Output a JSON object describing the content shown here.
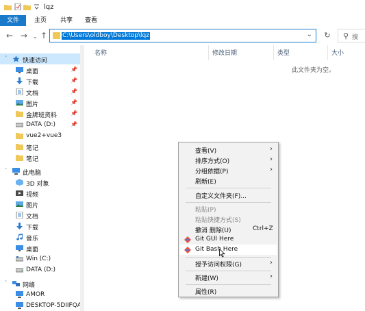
{
  "window": {
    "title": "lqz"
  },
  "ribbon": {
    "tabs": [
      "文件",
      "主页",
      "共享",
      "查看"
    ]
  },
  "address": {
    "path": "C:\\Users\\oldboy\\Desktop\\lqz",
    "search_placeholder": "搜"
  },
  "sidebar": {
    "items": [
      {
        "label": "快速访问",
        "icon": "star-icon"
      },
      {
        "label": "桌面",
        "icon": "desktop-icon"
      },
      {
        "label": "下载",
        "icon": "download-icon"
      },
      {
        "label": "文档",
        "icon": "document-icon"
      },
      {
        "label": "图片",
        "icon": "picture-icon"
      },
      {
        "label": "金牌班资料",
        "icon": "folder-icon"
      },
      {
        "label": "DATA (D:)",
        "icon": "drive-icon"
      },
      {
        "label": "vue2+vue3",
        "icon": "folder-icon"
      },
      {
        "label": "笔记",
        "icon": "folder-icon"
      },
      {
        "label": "笔记",
        "icon": "folder-icon"
      },
      {
        "label": "此电脑",
        "icon": "computer-icon"
      },
      {
        "label": "3D 对象",
        "icon": "3d-objects-icon"
      },
      {
        "label": "视频",
        "icon": "video-icon"
      },
      {
        "label": "图片",
        "icon": "picture-icon"
      },
      {
        "label": "文档",
        "icon": "document-icon"
      },
      {
        "label": "下载",
        "icon": "download-icon"
      },
      {
        "label": "音乐",
        "icon": "music-icon"
      },
      {
        "label": "桌面",
        "icon": "desktop-icon"
      },
      {
        "label": "Win (C:)",
        "icon": "drive-icon"
      },
      {
        "label": "DATA (D:)",
        "icon": "drive-icon"
      },
      {
        "label": "网络",
        "icon": "network-icon"
      },
      {
        "label": "AMOR",
        "icon": "network-computer-icon"
      },
      {
        "label": "DESKTOP-5DIIFQA",
        "icon": "network-computer-icon"
      }
    ]
  },
  "columns": {
    "name": "名称",
    "date": "修改日期",
    "type": "类型",
    "size": "大小"
  },
  "content": {
    "empty_message": "此文件夹为空。"
  },
  "context_menu": {
    "items": [
      {
        "label": "查看(V)"
      },
      {
        "label": "排序方式(O)"
      },
      {
        "label": "分组依据(P)"
      },
      {
        "label": "刷新(E)"
      },
      {
        "label": "自定义文件夹(F)..."
      },
      {
        "label": "粘贴(P)"
      },
      {
        "label": "粘贴快捷方式(S)"
      },
      {
        "label": "撤消 删除(U)",
        "shortcut": "Ctrl+Z"
      },
      {
        "label": "Git GUI Here"
      },
      {
        "label": "Git Bash Here"
      },
      {
        "label": "授予访问权限(G)"
      },
      {
        "label": "新建(W)"
      },
      {
        "label": "属性(R)"
      }
    ]
  },
  "colors": {
    "accent": "#1979ca",
    "folder": "#f0c85a",
    "selection": "#cce8ff"
  }
}
